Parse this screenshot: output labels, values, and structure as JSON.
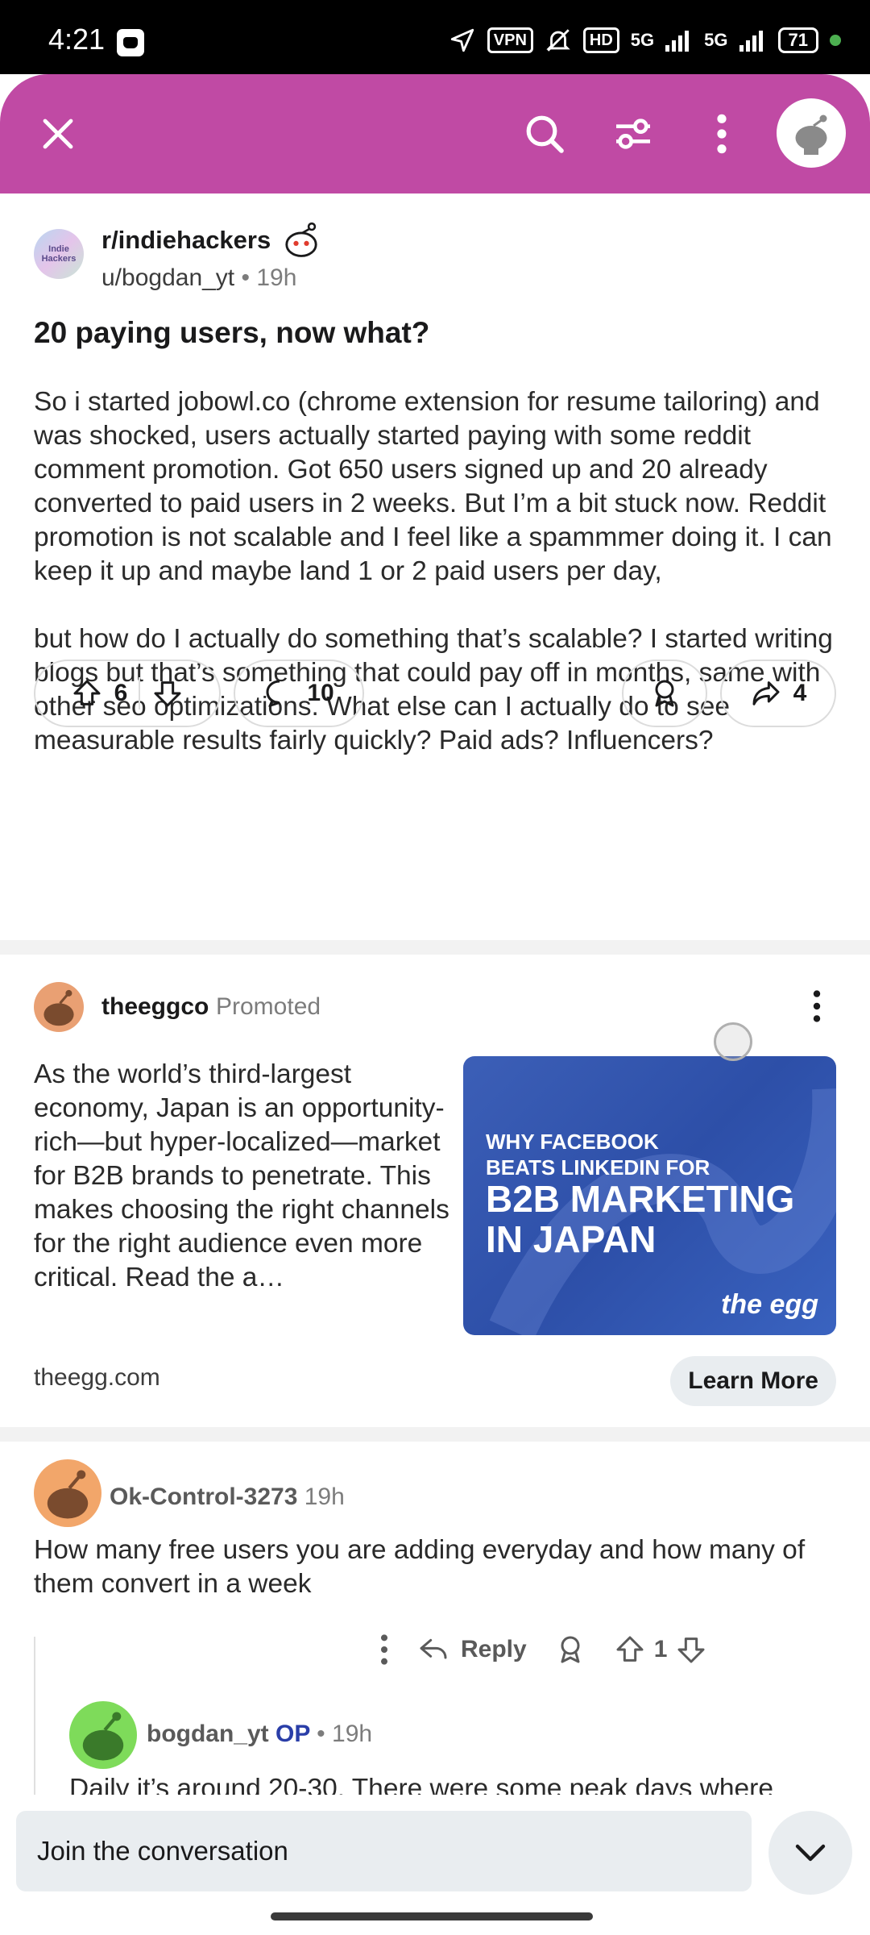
{
  "status_bar": {
    "time": "4:21",
    "vpn": "VPN",
    "hd": "HD",
    "net1": "5G",
    "net2": "5G",
    "battery": "71"
  },
  "post": {
    "subreddit": "r/indiehackers",
    "subreddit_avatar_text": "Indie Hackers",
    "author": "u/bogdan_yt",
    "age": "19h",
    "title": "20 paying users, now what?",
    "body_p1": "So i started jobowl.co (chrome extension for resume tailoring) and was shocked, users actually started paying with some reddit comment promotion. Got 650 users signed up and 20 already converted to paid users in 2 weeks. But I’m a bit stuck now. Reddit promotion is not scalable and I feel like a spammmer doing it. I can keep it up and maybe land 1 or 2 paid users per day,",
    "body_p2": "but how do I actually do something that’s scalable? I started writing blogs but that’s something that could pay off in months, same with other seo optimizations. What else can I actually do to see measurable results fairly quickly? Paid ads? Influencers?",
    "upvotes": "6",
    "comments": "10",
    "shares": "4"
  },
  "promo": {
    "advertiser": "theeggco",
    "tag": "Promoted",
    "text": "As the world’s third-largest economy, Japan is an opportunity-rich—but hyper-localized—market for B2B brands to penetrate. This makes choosing the right channels for the right audience even more critical. Read the a…",
    "image_line1": "WHY FACEBOOK BEATS LINKEDIN FOR",
    "image_line2": "B2B MARKETING IN JAPAN",
    "image_logo": "the egg",
    "domain": "theegg.com",
    "cta": "Learn More"
  },
  "comments": [
    {
      "user": "Ok-Control-3273",
      "age": "19h",
      "text": "How many free users you are adding everyday and how many of them convert in a week",
      "reply_label": "Reply",
      "votes": "1"
    },
    {
      "user": "bogdan_yt",
      "op": "OP",
      "age": "19h",
      "text": "Daily it’s around 20-30. There were some peak days where"
    }
  ],
  "composer": {
    "placeholder": "Join the conversation"
  },
  "colors": {
    "header": "#c04aa4",
    "op": "#2a3ea8"
  }
}
